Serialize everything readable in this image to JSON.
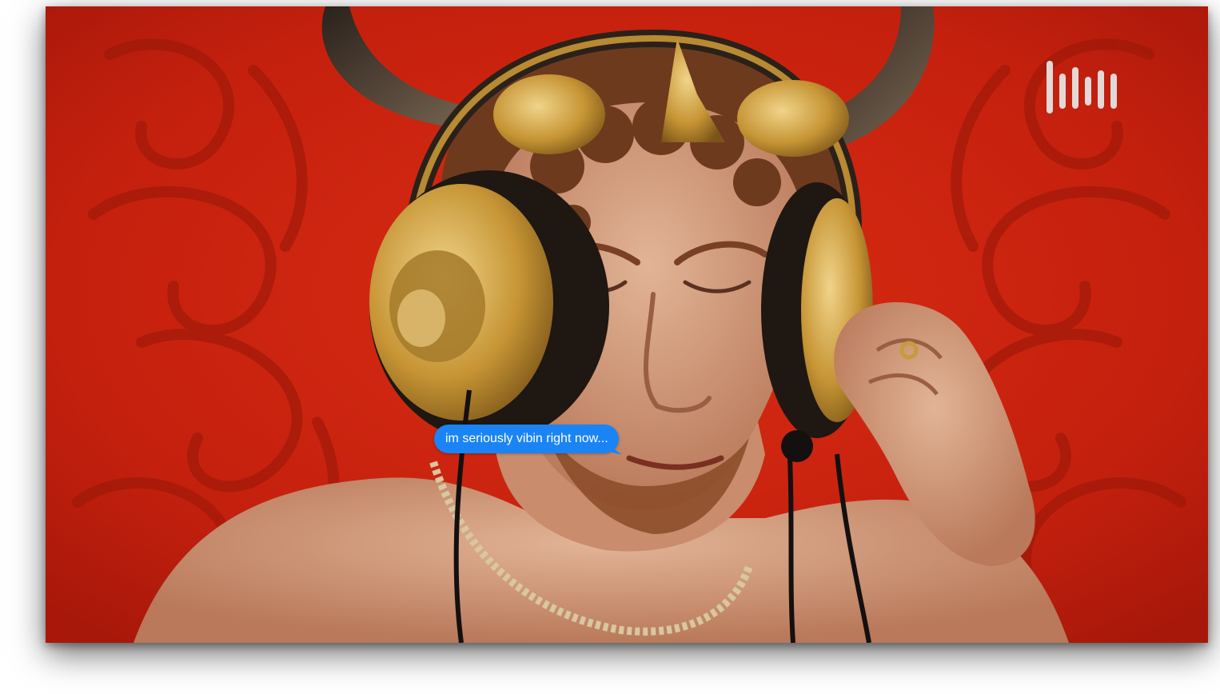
{
  "image": {
    "subject": "horned figure wearing gold headphones on red ornate background",
    "colors": {
      "background_red": "#c8210e",
      "pattern_red": "#9e1a0a",
      "horn": "#3a2e26",
      "gold": "#c79a3d",
      "skin": "#d6a080",
      "hair": "#6e3a1e",
      "bubble_blue": "#1a84f5"
    }
  },
  "logo": {
    "icon": "audio-waveform-logo-icon"
  },
  "message": {
    "text": "im seriously vibin right now..."
  }
}
